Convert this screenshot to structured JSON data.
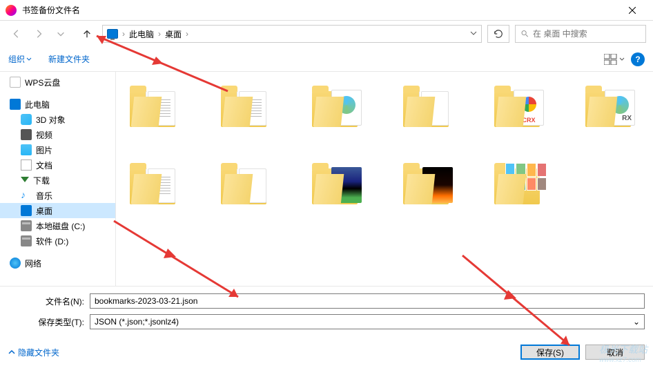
{
  "titlebar": {
    "title": "书签备份文件名"
  },
  "nav": {
    "breadcrumb": [
      "此电脑",
      "桌面"
    ],
    "search_placeholder": "在 桌面 中搜索"
  },
  "toolbar": {
    "organize": "组织",
    "newfolder": "新建文件夹"
  },
  "sidebar": {
    "items": [
      {
        "label": "WPS云盘",
        "icon": "icon-cloud",
        "indent": 0
      },
      {
        "label": "此电脑",
        "icon": "icon-pc",
        "indent": 0
      },
      {
        "label": "3D 对象",
        "icon": "icon-3d",
        "indent": 1
      },
      {
        "label": "视频",
        "icon": "icon-video",
        "indent": 1
      },
      {
        "label": "图片",
        "icon": "icon-pics",
        "indent": 1
      },
      {
        "label": "文档",
        "icon": "icon-docs",
        "indent": 1
      },
      {
        "label": "下载",
        "icon": "icon-dl",
        "indent": 1
      },
      {
        "label": "音乐",
        "icon": "icon-music",
        "indent": 1
      },
      {
        "label": "桌面",
        "icon": "icon-desk",
        "indent": 1,
        "selected": true
      },
      {
        "label": "本地磁盘 (C:)",
        "icon": "icon-disk",
        "indent": 1
      },
      {
        "label": "软件 (D:)",
        "icon": "icon-disk",
        "indent": 1
      },
      {
        "label": "网络",
        "icon": "icon-net",
        "indent": 0
      }
    ]
  },
  "fields": {
    "filename_label": "文件名(N):",
    "filename_value": "bookmarks-2023-03-21.json",
    "filetype_label": "保存类型(T):",
    "filetype_value": "JSON (*.json;*.jsonlz4)"
  },
  "buttons": {
    "hide_folders": "隐藏文件夹",
    "save": "保存(S)",
    "cancel": "取消"
  },
  "watermark": {
    "main": "极光下载站",
    "sub": "www.xz7.com"
  }
}
